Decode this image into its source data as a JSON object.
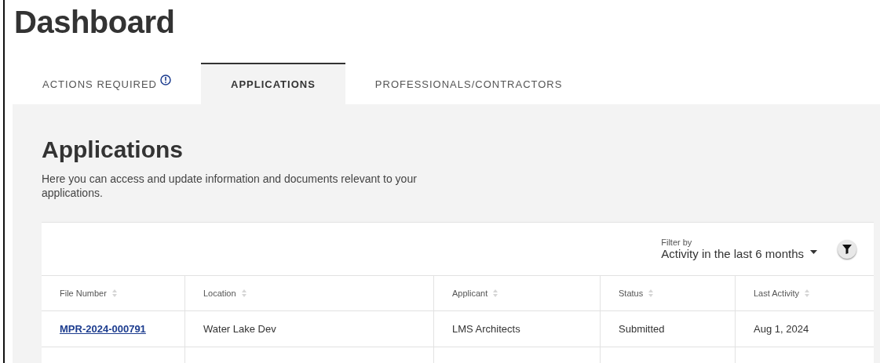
{
  "page": {
    "title": "Dashboard"
  },
  "tabs": [
    {
      "label": "ACTIONS REQUIRED",
      "selected": false,
      "alert": true
    },
    {
      "label": "APPLICATIONS",
      "selected": true,
      "alert": false
    },
    {
      "label": "PROFESSIONALS/CONTRACTORS",
      "selected": false,
      "alert": false
    }
  ],
  "section": {
    "title": "Applications",
    "description": "Here you can access and update information and documents relevant to your applications."
  },
  "filter": {
    "label": "Filter by",
    "value": "Activity in the last 6 months"
  },
  "table": {
    "columns": [
      "File Number",
      "Location",
      "Applicant",
      "Status",
      "Last Activity"
    ],
    "rows": [
      {
        "file_number": "MPR-2024-000791",
        "location": "Water Lake Dev",
        "applicant": "LMS Architects",
        "status": "Submitted",
        "last_activity": "Aug 1, 2024"
      }
    ]
  }
}
